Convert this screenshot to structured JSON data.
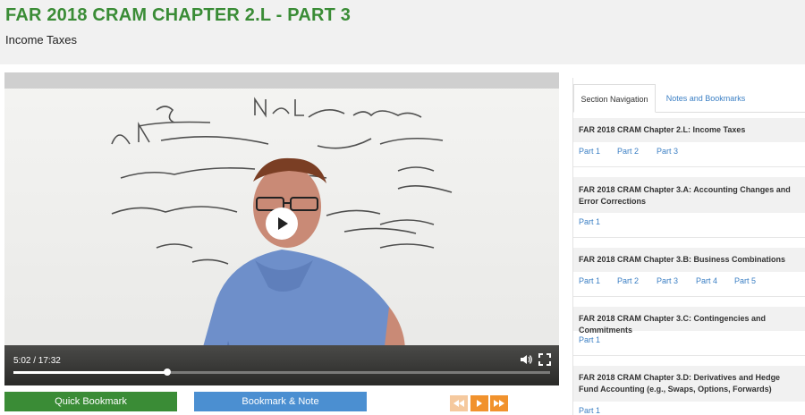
{
  "page": {
    "title": "FAR 2018 CRAM CHAPTER 2.L - PART 3",
    "subtitle": "Income Taxes"
  },
  "video": {
    "time_display": "5:02 / 17:32",
    "progress_fraction": 0.287,
    "state": "paused"
  },
  "buttons": {
    "quick_bookmark": "Quick Bookmark",
    "bookmark_note": "Bookmark & Note"
  },
  "tabs": [
    {
      "label": "Section Navigation",
      "active": true
    },
    {
      "label": "Notes and Bookmarks",
      "active": false
    }
  ],
  "sections": [
    {
      "title": "FAR 2018 CRAM Chapter 2.L: Income Taxes",
      "parts": [
        "Part 1",
        "Part 2",
        "Part 3"
      ]
    },
    {
      "title": "FAR 2018 CRAM Chapter 3.A: Accounting Changes and Error Corrections",
      "parts": [
        "Part 1"
      ]
    },
    {
      "title": "FAR 2018 CRAM Chapter 3.B: Business Combinations",
      "parts": [
        "Part 1",
        "Part 2",
        "Part 3",
        "Part 4",
        "Part 5"
      ]
    },
    {
      "title": "FAR 2018 CRAM Chapter 3.C: Contingencies and Commitments",
      "parts": [
        "Part 1"
      ]
    },
    {
      "title": "FAR 2018 CRAM Chapter 3.D: Derivatives and Hedge Fund Accounting (e.g., Swaps, Options, Forwards)",
      "parts": [
        "Part 1"
      ]
    }
  ],
  "colors": {
    "title_green": "#3a8c36",
    "button_blue": "#4b8fd1",
    "nav_orange": "#f1922d",
    "link_blue": "#3b7fc4"
  }
}
